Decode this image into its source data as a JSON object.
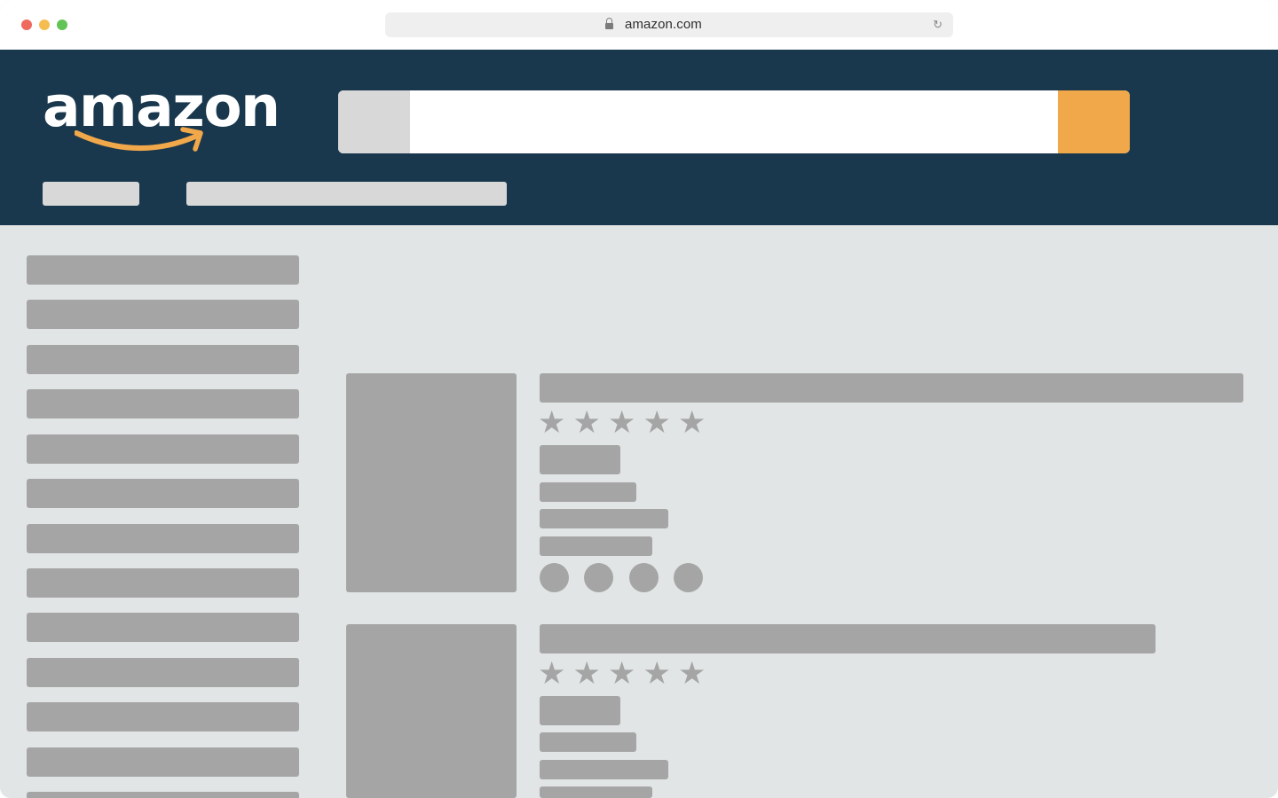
{
  "browser": {
    "url": "amazon.com",
    "lock_icon": "lock-icon",
    "reload_icon": "reload-icon",
    "reload_glyph": "↻"
  },
  "header": {
    "logo_text": "amazon",
    "search": {
      "value": "",
      "placeholder": ""
    },
    "colors": {
      "header_bg": "#1a384d",
      "search_button": "#f1a84a",
      "logo_smile": "#f1a84a"
    }
  },
  "sidebar": {
    "item_count": 13
  },
  "products": [
    {
      "stars": [
        "★",
        "★",
        "★",
        "★",
        "★"
      ],
      "swatch_count": 4
    },
    {
      "stars": [
        "★",
        "★",
        "★",
        "★",
        "★"
      ],
      "swatch_count": 0
    }
  ]
}
